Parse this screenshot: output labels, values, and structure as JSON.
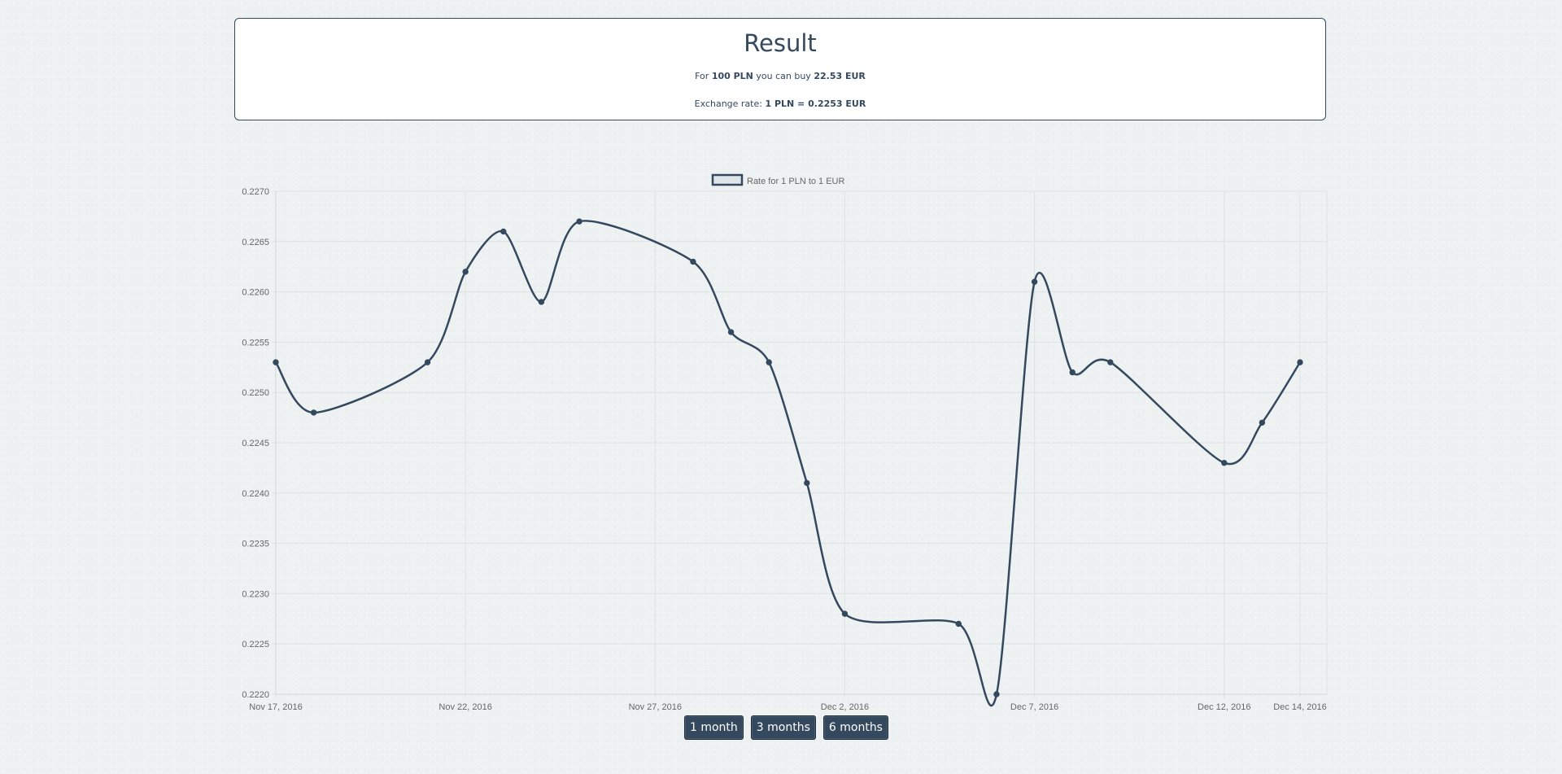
{
  "result": {
    "title": "Result",
    "buy_prefix": "For",
    "amount": "100 PLN",
    "buy_middle": "you can buy",
    "converted": "22.53 EUR",
    "rate_prefix": "Exchange rate:",
    "rate_value": "1 PLN = 0.2253 EUR"
  },
  "range_buttons": [
    "1 month",
    "3 months",
    "6 months"
  ],
  "colors": {
    "accent": "#34495e",
    "page_background": "#eef1f2",
    "grid": "#dde2e5"
  },
  "chart_data": {
    "type": "line",
    "series": [
      {
        "name": "Rate for 1 PLN to 1 EUR",
        "points": [
          [
            "2016-11-17",
            0.2253
          ],
          [
            "2016-11-18",
            0.2248
          ],
          [
            "2016-11-21",
            0.2253
          ],
          [
            "2016-11-22",
            0.2262
          ],
          [
            "2016-11-23",
            0.2266
          ],
          [
            "2016-11-24",
            0.2259
          ],
          [
            "2016-11-25",
            0.2267
          ],
          [
            "2016-11-28",
            0.2263
          ],
          [
            "2016-11-29",
            0.2256
          ],
          [
            "2016-11-30",
            0.2253
          ],
          [
            "2016-12-01",
            0.2241
          ],
          [
            "2016-12-02",
            0.2228
          ],
          [
            "2016-12-05",
            0.2227
          ],
          [
            "2016-12-06",
            0.222
          ],
          [
            "2016-12-07",
            0.2261
          ],
          [
            "2016-12-08",
            0.2252
          ],
          [
            "2016-12-09",
            0.2253
          ],
          [
            "2016-12-12",
            0.2243
          ],
          [
            "2016-12-13",
            0.2247
          ],
          [
            "2016-12-14",
            0.2253
          ]
        ]
      }
    ],
    "x_range": [
      "2016-11-17",
      "2016-12-14"
    ],
    "x_ticks": [
      {
        "date": "2016-11-17",
        "label": "Nov 17, 2016"
      },
      {
        "date": "2016-11-22",
        "label": "Nov 22, 2016"
      },
      {
        "date": "2016-11-27",
        "label": "Nov 27, 2016"
      },
      {
        "date": "2016-12-02",
        "label": "Dec 2, 2016"
      },
      {
        "date": "2016-12-07",
        "label": "Dec 7, 2016"
      },
      {
        "date": "2016-12-12",
        "label": "Dec 12, 2016"
      },
      {
        "date": "2016-12-14",
        "label": "Dec 14, 2016"
      }
    ],
    "y_ticks": [
      "0.2270",
      "0.2265",
      "0.2260",
      "0.2255",
      "0.2250",
      "0.2245",
      "0.2240",
      "0.2235",
      "0.2230",
      "0.2225",
      "0.2220"
    ],
    "ylim": [
      0.222,
      0.227
    ],
    "grid": true,
    "legend": "top-center",
    "line_color": "#34495e"
  }
}
